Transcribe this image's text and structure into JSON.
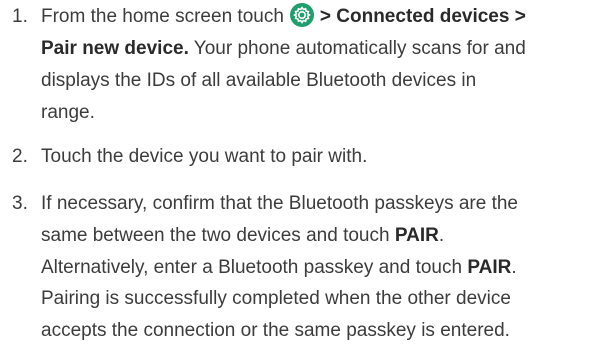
{
  "steps": [
    {
      "number": "1.",
      "line1_pre": "From the home screen touch",
      "icon": "settings-gear-icon",
      "line1_bold": "> Connected devices >",
      "line2_bold": "Pair new device.",
      "line2_rest": " Your phone automatically scans for and",
      "line3": "displays the IDs of all available Bluetooth devices in",
      "line4": "range."
    },
    {
      "number": "2.",
      "line1": "Touch the device you want to pair with."
    },
    {
      "number": "3.",
      "line1": "If necessary, confirm that the Bluetooth passkeys are the",
      "line2_pre": "same between the two devices and touch ",
      "line2_bold": "PAIR",
      "line2_post": ".",
      "line3_pre": "Alternatively, enter a Bluetooth passkey and touch ",
      "line3_bold": "PAIR",
      "line3_post": "."
    }
  ],
  "note": {
    "line1": "Pairing is successfully completed when the other device",
    "line2": "accepts the connection or the same passkey is entered."
  },
  "colors": {
    "text": "#3c3c3c",
    "icon_green": "#1f9e6e"
  }
}
